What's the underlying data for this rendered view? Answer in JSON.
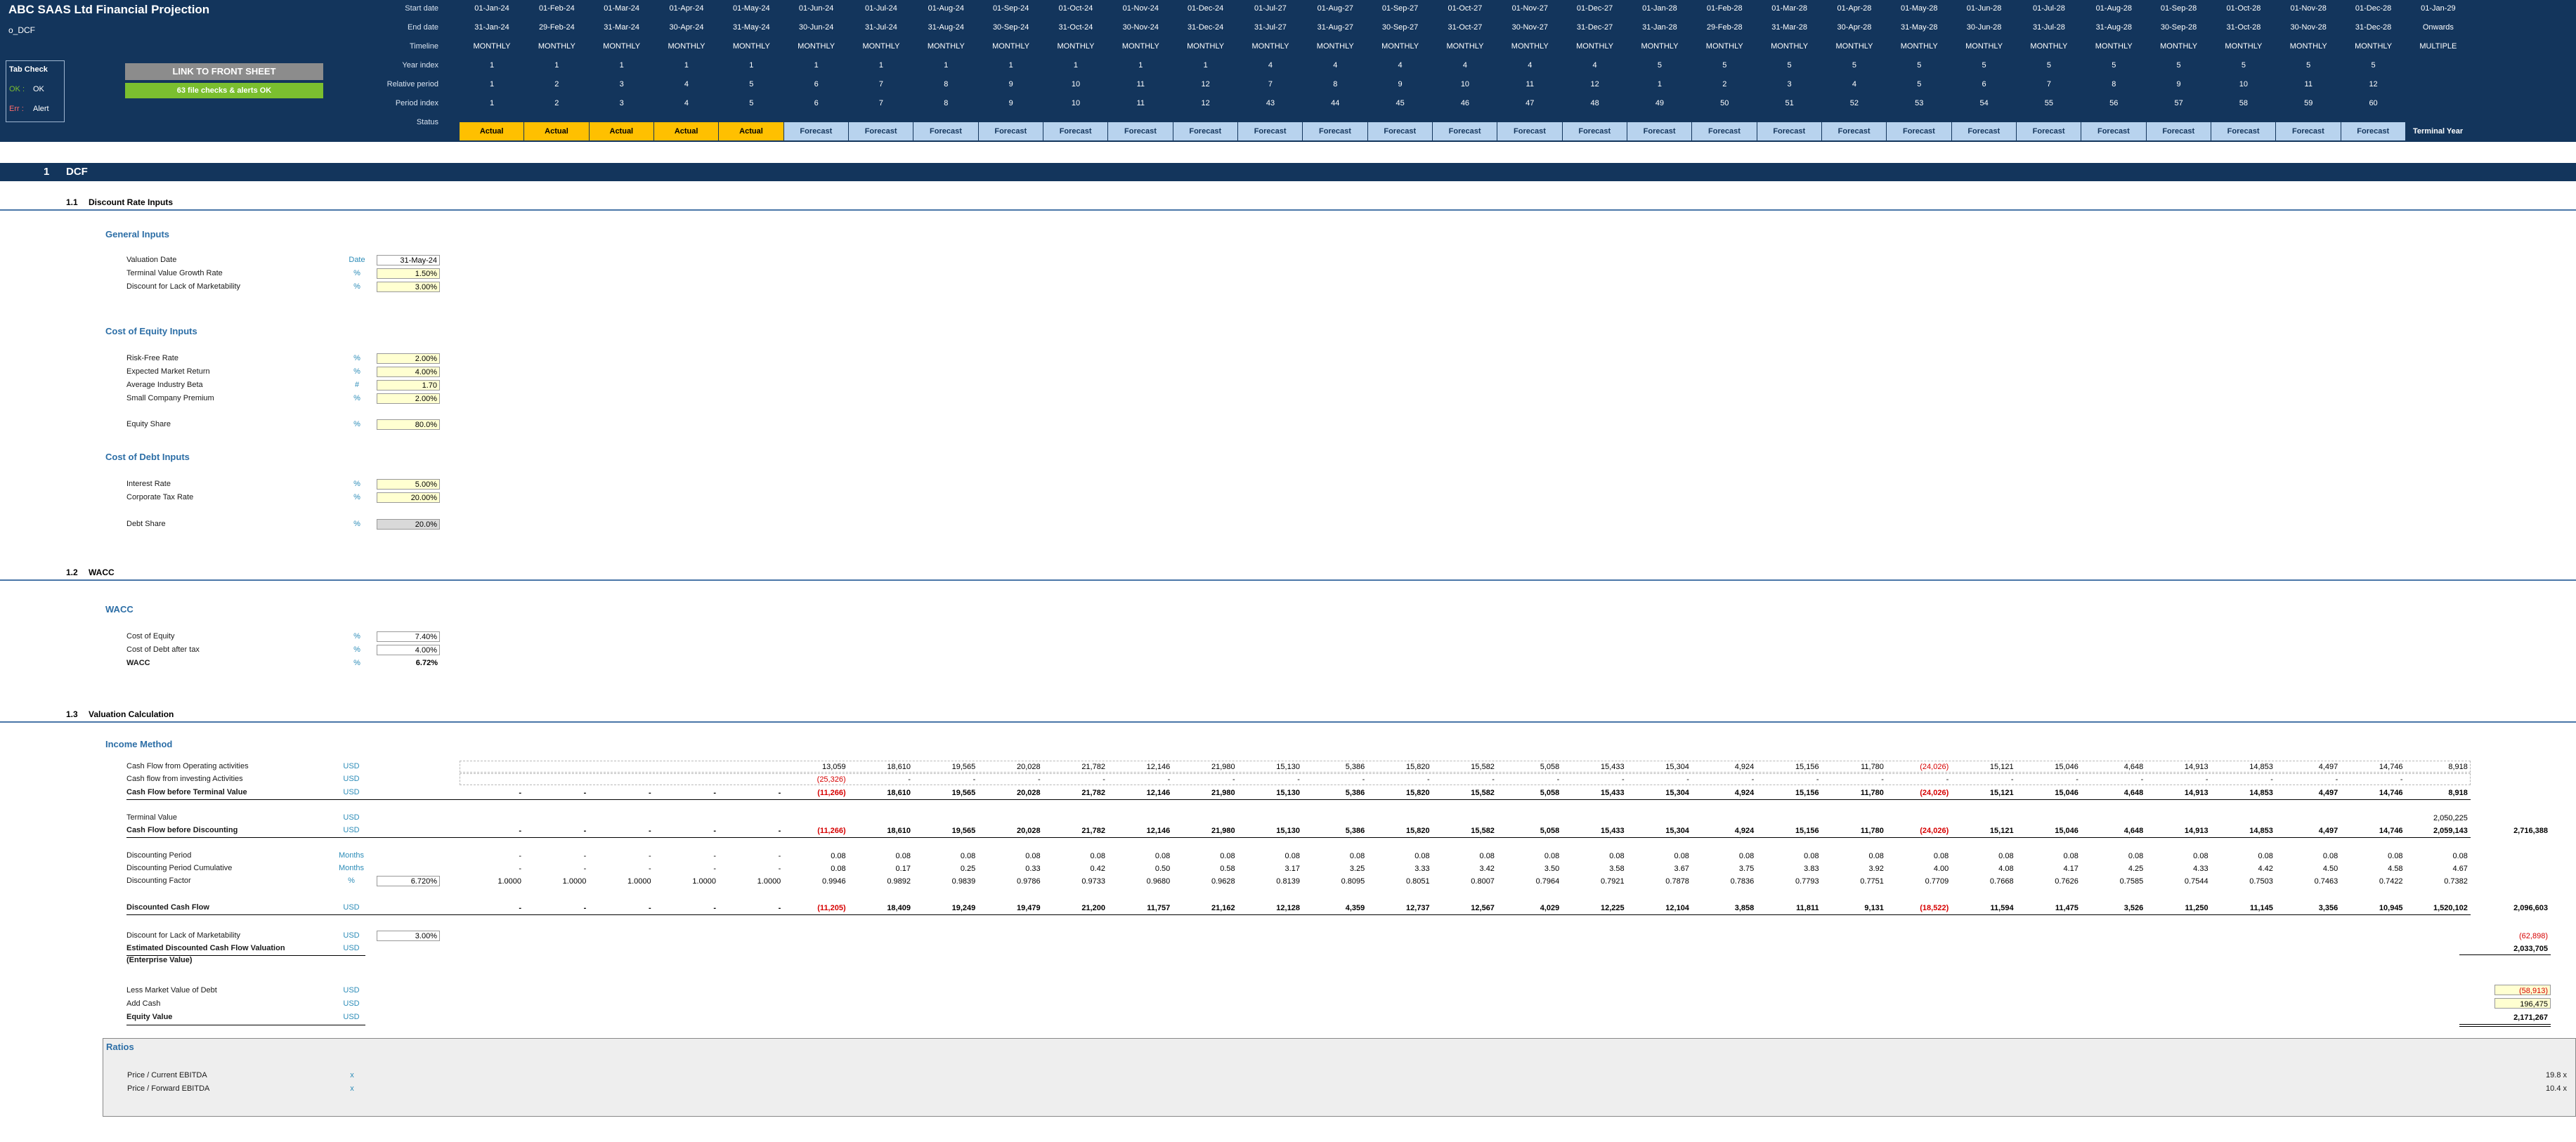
{
  "header": {
    "title": "ABC SAAS Ltd Financial Projection",
    "sheet": "o_DCF",
    "tab_check": {
      "title": "Tab Check",
      "ok": "OK",
      "err": "Alert",
      "ok_prefix": "OK :",
      "err_prefix": "Err :"
    },
    "link_button": "LINK TO FRONT SHEET",
    "checks_status": "63 file checks & alerts OK",
    "row_labels": [
      "Start date",
      "End date",
      "Timeline",
      "Year index",
      "Relative period",
      "Period index",
      "Status"
    ],
    "columns": [
      {
        "start": "01-Jan-24",
        "end": "31-Jan-24",
        "timeline": "MONTHLY",
        "year": "1",
        "rel": "1",
        "period": "1",
        "status": "Actual"
      },
      {
        "start": "01-Feb-24",
        "end": "29-Feb-24",
        "timeline": "MONTHLY",
        "year": "1",
        "rel": "2",
        "period": "2",
        "status": "Actual"
      },
      {
        "start": "01-Mar-24",
        "end": "31-Mar-24",
        "timeline": "MONTHLY",
        "year": "1",
        "rel": "3",
        "period": "3",
        "status": "Actual"
      },
      {
        "start": "01-Apr-24",
        "end": "30-Apr-24",
        "timeline": "MONTHLY",
        "year": "1",
        "rel": "4",
        "period": "4",
        "status": "Actual"
      },
      {
        "start": "01-May-24",
        "end": "31-May-24",
        "timeline": "MONTHLY",
        "year": "1",
        "rel": "5",
        "period": "5",
        "status": "Actual"
      },
      {
        "start": "01-Jun-24",
        "end": "30-Jun-24",
        "timeline": "MONTHLY",
        "year": "1",
        "rel": "6",
        "period": "6",
        "status": "Forecast"
      },
      {
        "start": "01-Jul-24",
        "end": "31-Jul-24",
        "timeline": "MONTHLY",
        "year": "1",
        "rel": "7",
        "period": "7",
        "status": "Forecast"
      },
      {
        "start": "01-Aug-24",
        "end": "31-Aug-24",
        "timeline": "MONTHLY",
        "year": "1",
        "rel": "8",
        "period": "8",
        "status": "Forecast"
      },
      {
        "start": "01-Sep-24",
        "end": "30-Sep-24",
        "timeline": "MONTHLY",
        "year": "1",
        "rel": "9",
        "period": "9",
        "status": "Forecast"
      },
      {
        "start": "01-Oct-24",
        "end": "31-Oct-24",
        "timeline": "MONTHLY",
        "year": "1",
        "rel": "10",
        "period": "10",
        "status": "Forecast"
      },
      {
        "start": "01-Nov-24",
        "end": "30-Nov-24",
        "timeline": "MONTHLY",
        "year": "1",
        "rel": "11",
        "period": "11",
        "status": "Forecast"
      },
      {
        "start": "01-Dec-24",
        "end": "31-Dec-24",
        "timeline": "MONTHLY",
        "year": "1",
        "rel": "12",
        "period": "12",
        "status": "Forecast"
      },
      {
        "start": "01-Jul-27",
        "end": "31-Jul-27",
        "timeline": "MONTHLY",
        "year": "4",
        "rel": "7",
        "period": "43",
        "status": "Forecast"
      },
      {
        "start": "01-Aug-27",
        "end": "31-Aug-27",
        "timeline": "MONTHLY",
        "year": "4",
        "rel": "8",
        "period": "44",
        "status": "Forecast"
      },
      {
        "start": "01-Sep-27",
        "end": "30-Sep-27",
        "timeline": "MONTHLY",
        "year": "4",
        "rel": "9",
        "period": "45",
        "status": "Forecast"
      },
      {
        "start": "01-Oct-27",
        "end": "31-Oct-27",
        "timeline": "MONTHLY",
        "year": "4",
        "rel": "10",
        "period": "46",
        "status": "Forecast"
      },
      {
        "start": "01-Nov-27",
        "end": "30-Nov-27",
        "timeline": "MONTHLY",
        "year": "4",
        "rel": "11",
        "period": "47",
        "status": "Forecast"
      },
      {
        "start": "01-Dec-27",
        "end": "31-Dec-27",
        "timeline": "MONTHLY",
        "year": "4",
        "rel": "12",
        "period": "48",
        "status": "Forecast"
      },
      {
        "start": "01-Jan-28",
        "end": "31-Jan-28",
        "timeline": "MONTHLY",
        "year": "5",
        "rel": "1",
        "period": "49",
        "status": "Forecast"
      },
      {
        "start": "01-Feb-28",
        "end": "29-Feb-28",
        "timeline": "MONTHLY",
        "year": "5",
        "rel": "2",
        "period": "50",
        "status": "Forecast"
      },
      {
        "start": "01-Mar-28",
        "end": "31-Mar-28",
        "timeline": "MONTHLY",
        "year": "5",
        "rel": "3",
        "period": "51",
        "status": "Forecast"
      },
      {
        "start": "01-Apr-28",
        "end": "30-Apr-28",
        "timeline": "MONTHLY",
        "year": "5",
        "rel": "4",
        "period": "52",
        "status": "Forecast"
      },
      {
        "start": "01-May-28",
        "end": "31-May-28",
        "timeline": "MONTHLY",
        "year": "5",
        "rel": "5",
        "period": "53",
        "status": "Forecast"
      },
      {
        "start": "01-Jun-28",
        "end": "30-Jun-28",
        "timeline": "MONTHLY",
        "year": "5",
        "rel": "6",
        "period": "54",
        "status": "Forecast"
      },
      {
        "start": "01-Jul-28",
        "end": "31-Jul-28",
        "timeline": "MONTHLY",
        "year": "5",
        "rel": "7",
        "period": "55",
        "status": "Forecast"
      },
      {
        "start": "01-Aug-28",
        "end": "31-Aug-28",
        "timeline": "MONTHLY",
        "year": "5",
        "rel": "8",
        "period": "56",
        "status": "Forecast"
      },
      {
        "start": "01-Sep-28",
        "end": "30-Sep-28",
        "timeline": "MONTHLY",
        "year": "5",
        "rel": "9",
        "period": "57",
        "status": "Forecast"
      },
      {
        "start": "01-Oct-28",
        "end": "31-Oct-28",
        "timeline": "MONTHLY",
        "year": "5",
        "rel": "10",
        "period": "58",
        "status": "Forecast"
      },
      {
        "start": "01-Nov-28",
        "end": "30-Nov-28",
        "timeline": "MONTHLY",
        "year": "5",
        "rel": "11",
        "period": "59",
        "status": "Forecast"
      },
      {
        "start": "01-Dec-28",
        "end": "31-Dec-28",
        "timeline": "MONTHLY",
        "year": "5",
        "rel": "12",
        "period": "60",
        "status": "Forecast"
      },
      {
        "start": "01-Jan-29",
        "end": "Onwards",
        "timeline": "MULTIPLE",
        "year": "",
        "rel": "",
        "period": "",
        "status": "Terminal Year"
      }
    ]
  },
  "section": {
    "num": "1",
    "title": "DCF"
  },
  "subsections": [
    {
      "num": "1.1",
      "title": "Discount Rate Inputs"
    },
    {
      "num": "1.2",
      "title": "WACC"
    },
    {
      "num": "1.3",
      "title": "Valuation Calculation"
    }
  ],
  "general_inputs": {
    "title": "General Inputs",
    "rows": [
      {
        "label": "Valuation Date",
        "unit": "Date",
        "value": "31-May-24"
      },
      {
        "label": "Terminal Value Growth Rate",
        "unit": "%",
        "value": "1.50%"
      },
      {
        "label": "Discount for Lack of Marketability",
        "unit": "%",
        "value": "3.00%"
      }
    ]
  },
  "equity_inputs": {
    "title": "Cost of Equity Inputs",
    "rows": [
      {
        "label": "Risk-Free Rate",
        "unit": "%",
        "value": "2.00%"
      },
      {
        "label": "Expected Market Return",
        "unit": "%",
        "value": "4.00%"
      },
      {
        "label": "Average Industry Beta",
        "unit": "#",
        "value": "1.70"
      },
      {
        "label": "Small Company Premium",
        "unit": "%",
        "value": "2.00%"
      }
    ],
    "share": {
      "label": "Equity Share",
      "unit": "%",
      "value": "80.0%"
    }
  },
  "debt_inputs": {
    "title": "Cost of Debt Inputs",
    "rows": [
      {
        "label": "Interest Rate",
        "unit": "%",
        "value": "5.00%"
      },
      {
        "label": "Corporate Tax Rate",
        "unit": "%",
        "value": "20.00%"
      }
    ],
    "share": {
      "label": "Debt Share",
      "unit": "%",
      "value": "20.0%"
    }
  },
  "wacc": {
    "title": "WACC",
    "rows": [
      {
        "label": "Cost of Equity",
        "unit": "%",
        "value": "7.40%"
      },
      {
        "label": "Cost of Debt after tax",
        "unit": "%",
        "value": "4.00%"
      },
      {
        "label": "WACC",
        "unit": "%",
        "value": "6.72%"
      }
    ]
  },
  "income_method": {
    "title": "Income Method",
    "rows": [
      {
        "label": "Cash Flow from Operating activities",
        "unit": "USD",
        "bold": false,
        "pre": "",
        "values": [
          "",
          "",
          "",
          "",
          "",
          "13,059",
          "18,610",
          "19,565",
          "20,028",
          "21,782",
          "12,146",
          "21,980",
          "15,130",
          "5,386",
          "15,820",
          "15,582",
          "5,058",
          "15,433",
          "15,304",
          "4,924",
          "15,156",
          "11,780",
          "(24,026)",
          "15,121",
          "15,046",
          "4,648",
          "14,913",
          "14,853",
          "4,497",
          "14,746",
          "8,918"
        ],
        "outer": ""
      },
      {
        "label": "Cash flow from investing Activities",
        "unit": "USD",
        "bold": false,
        "pre": "",
        "values": [
          "",
          "",
          "",
          "",
          "",
          "(25,326)",
          "-",
          "-",
          "-",
          "-",
          "-",
          "-",
          "-",
          "-",
          "-",
          "-",
          "-",
          "-",
          "-",
          "-",
          "-",
          "-",
          "-",
          "-",
          "-",
          "-",
          "-",
          "-",
          "-",
          "-",
          ""
        ],
        "outer": ""
      },
      {
        "label": "Cash Flow before Terminal Value",
        "unit": "USD",
        "bold": true,
        "pre": "",
        "values": [
          "-",
          "-",
          "-",
          "-",
          "-",
          "(11,266)",
          "18,610",
          "19,565",
          "20,028",
          "21,782",
          "12,146",
          "21,980",
          "15,130",
          "5,386",
          "15,820",
          "15,582",
          "5,058",
          "15,433",
          "15,304",
          "4,924",
          "15,156",
          "11,780",
          "(24,026)",
          "15,121",
          "15,046",
          "4,648",
          "14,913",
          "14,853",
          "4,497",
          "14,746",
          "8,918"
        ],
        "outer": ""
      },
      {
        "label": "Terminal Value",
        "unit": "USD",
        "bold": false,
        "pre": "",
        "values": [
          "",
          "",
          "",
          "",
          "",
          "",
          "",
          "",
          "",
          "",
          "",
          "",
          "",
          "",
          "",
          "",
          "",
          "",
          "",
          "",
          "",
          "",
          "",
          "",
          "",
          "",
          "",
          "",
          "",
          "",
          "2,050,225"
        ],
        "outer": ""
      },
      {
        "label": "Cash Flow before Discounting",
        "unit": "USD",
        "bold": true,
        "pre": "",
        "values": [
          "-",
          "-",
          "-",
          "-",
          "-",
          "(11,266)",
          "18,610",
          "19,565",
          "20,028",
          "21,782",
          "12,146",
          "21,980",
          "15,130",
          "5,386",
          "15,820",
          "15,582",
          "5,058",
          "15,433",
          "15,304",
          "4,924",
          "15,156",
          "11,780",
          "(24,026)",
          "15,121",
          "15,046",
          "4,648",
          "14,913",
          "14,853",
          "4,497",
          "14,746",
          "2,059,143"
        ],
        "outer": "2,716,388"
      },
      {
        "label": "Discounting Period",
        "unit": "Months",
        "bold": false,
        "pre": "",
        "values": [
          "-",
          "-",
          "-",
          "-",
          "-",
          "0.08",
          "0.08",
          "0.08",
          "0.08",
          "0.08",
          "0.08",
          "0.08",
          "0.08",
          "0.08",
          "0.08",
          "0.08",
          "0.08",
          "0.08",
          "0.08",
          "0.08",
          "0.08",
          "0.08",
          "0.08",
          "0.08",
          "0.08",
          "0.08",
          "0.08",
          "0.08",
          "0.08",
          "0.08",
          "0.08"
        ],
        "outer": ""
      },
      {
        "label": "Discounting Period Cumulative",
        "unit": "Months",
        "bold": false,
        "pre": "",
        "values": [
          "-",
          "-",
          "-",
          "-",
          "-",
          "0.08",
          "0.17",
          "0.25",
          "0.33",
          "0.42",
          "0.50",
          "0.58",
          "3.17",
          "3.25",
          "3.33",
          "3.42",
          "3.50",
          "3.58",
          "3.67",
          "3.75",
          "3.83",
          "3.92",
          "4.00",
          "4.08",
          "4.17",
          "4.25",
          "4.33",
          "4.42",
          "4.50",
          "4.58",
          "4.67"
        ],
        "outer": ""
      },
      {
        "label": "Discounting Factor",
        "unit": "%",
        "bold": false,
        "pre": "6.720%",
        "values": [
          "1.0000",
          "1.0000",
          "1.0000",
          "1.0000",
          "1.0000",
          "0.9946",
          "0.9892",
          "0.9839",
          "0.9786",
          "0.9733",
          "0.9680",
          "0.9628",
          "0.8139",
          "0.8095",
          "0.8051",
          "0.8007",
          "0.7964",
          "0.7921",
          "0.7878",
          "0.7836",
          "0.7793",
          "0.7751",
          "0.7709",
          "0.7668",
          "0.7626",
          "0.7585",
          "0.7544",
          "0.7503",
          "0.7463",
          "0.7422",
          "0.7382"
        ],
        "outer": ""
      },
      {
        "label": "Discounted Cash Flow",
        "unit": "USD",
        "bold": true,
        "pre": "",
        "values": [
          "-",
          "-",
          "-",
          "-",
          "-",
          "(11,205)",
          "18,409",
          "19,249",
          "19,479",
          "21,200",
          "11,757",
          "21,162",
          "12,128",
          "4,359",
          "12,737",
          "12,567",
          "4,029",
          "12,225",
          "12,104",
          "3,858",
          "11,811",
          "9,131",
          "(18,522)",
          "11,594",
          "11,475",
          "3,526",
          "11,250",
          "11,145",
          "3,356",
          "10,945",
          "1,520,102"
        ],
        "outer": "2,096,603"
      }
    ],
    "marketability": {
      "label": "Discount for Lack of Marketability",
      "unit": "USD",
      "value": "3.00%",
      "outer": "(62,898)"
    },
    "ev": {
      "label": "Estimated Discounted Cash Flow Valuation",
      "label2": "(Enterprise Value)",
      "unit": "USD",
      "outer": "2,033,705"
    },
    "debt": {
      "label": "Less Market Value of Debt",
      "unit": "USD",
      "outer": "(58,913)"
    },
    "cash": {
      "label": "Add Cash",
      "unit": "USD",
      "outer": "196,475"
    },
    "equity": {
      "label": "Equity Value",
      "unit": "USD",
      "outer": "2,171,267"
    }
  },
  "ratios": {
    "title": "Ratios",
    "rows": [
      {
        "label": "Price / Current EBITDA",
        "unit": "x",
        "value": "19.8 x"
      },
      {
        "label": "Price / Forward EBITDA",
        "unit": "x",
        "value": "10.4 x"
      }
    ]
  }
}
